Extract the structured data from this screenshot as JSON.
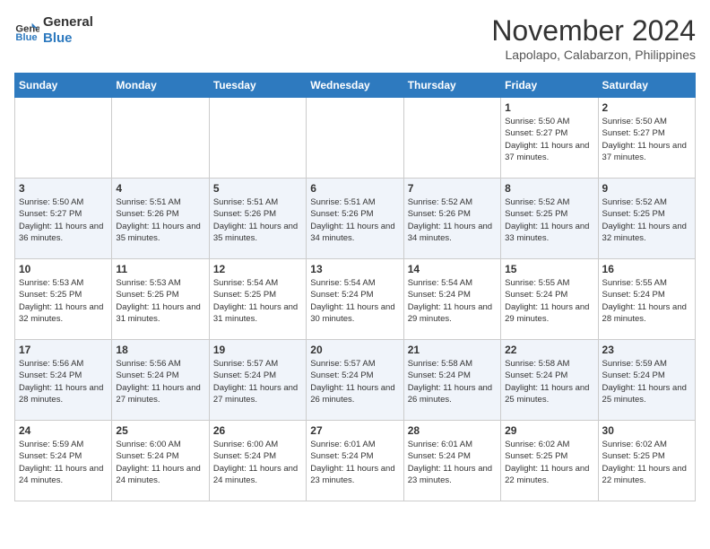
{
  "logo": {
    "line1": "General",
    "line2": "Blue"
  },
  "title": "November 2024",
  "location": "Lapolapo, Calabarzon, Philippines",
  "weekdays": [
    "Sunday",
    "Monday",
    "Tuesday",
    "Wednesday",
    "Thursday",
    "Friday",
    "Saturday"
  ],
  "weeks": [
    [
      {
        "day": "",
        "sunrise": "",
        "sunset": "",
        "daylight": ""
      },
      {
        "day": "",
        "sunrise": "",
        "sunset": "",
        "daylight": ""
      },
      {
        "day": "",
        "sunrise": "",
        "sunset": "",
        "daylight": ""
      },
      {
        "day": "",
        "sunrise": "",
        "sunset": "",
        "daylight": ""
      },
      {
        "day": "",
        "sunrise": "",
        "sunset": "",
        "daylight": ""
      },
      {
        "day": "1",
        "sunrise": "Sunrise: 5:50 AM",
        "sunset": "Sunset: 5:27 PM",
        "daylight": "Daylight: 11 hours and 37 minutes."
      },
      {
        "day": "2",
        "sunrise": "Sunrise: 5:50 AM",
        "sunset": "Sunset: 5:27 PM",
        "daylight": "Daylight: 11 hours and 37 minutes."
      }
    ],
    [
      {
        "day": "3",
        "sunrise": "Sunrise: 5:50 AM",
        "sunset": "Sunset: 5:27 PM",
        "daylight": "Daylight: 11 hours and 36 minutes."
      },
      {
        "day": "4",
        "sunrise": "Sunrise: 5:51 AM",
        "sunset": "Sunset: 5:26 PM",
        "daylight": "Daylight: 11 hours and 35 minutes."
      },
      {
        "day": "5",
        "sunrise": "Sunrise: 5:51 AM",
        "sunset": "Sunset: 5:26 PM",
        "daylight": "Daylight: 11 hours and 35 minutes."
      },
      {
        "day": "6",
        "sunrise": "Sunrise: 5:51 AM",
        "sunset": "Sunset: 5:26 PM",
        "daylight": "Daylight: 11 hours and 34 minutes."
      },
      {
        "day": "7",
        "sunrise": "Sunrise: 5:52 AM",
        "sunset": "Sunset: 5:26 PM",
        "daylight": "Daylight: 11 hours and 34 minutes."
      },
      {
        "day": "8",
        "sunrise": "Sunrise: 5:52 AM",
        "sunset": "Sunset: 5:25 PM",
        "daylight": "Daylight: 11 hours and 33 minutes."
      },
      {
        "day": "9",
        "sunrise": "Sunrise: 5:52 AM",
        "sunset": "Sunset: 5:25 PM",
        "daylight": "Daylight: 11 hours and 32 minutes."
      }
    ],
    [
      {
        "day": "10",
        "sunrise": "Sunrise: 5:53 AM",
        "sunset": "Sunset: 5:25 PM",
        "daylight": "Daylight: 11 hours and 32 minutes."
      },
      {
        "day": "11",
        "sunrise": "Sunrise: 5:53 AM",
        "sunset": "Sunset: 5:25 PM",
        "daylight": "Daylight: 11 hours and 31 minutes."
      },
      {
        "day": "12",
        "sunrise": "Sunrise: 5:54 AM",
        "sunset": "Sunset: 5:25 PM",
        "daylight": "Daylight: 11 hours and 31 minutes."
      },
      {
        "day": "13",
        "sunrise": "Sunrise: 5:54 AM",
        "sunset": "Sunset: 5:24 PM",
        "daylight": "Daylight: 11 hours and 30 minutes."
      },
      {
        "day": "14",
        "sunrise": "Sunrise: 5:54 AM",
        "sunset": "Sunset: 5:24 PM",
        "daylight": "Daylight: 11 hours and 29 minutes."
      },
      {
        "day": "15",
        "sunrise": "Sunrise: 5:55 AM",
        "sunset": "Sunset: 5:24 PM",
        "daylight": "Daylight: 11 hours and 29 minutes."
      },
      {
        "day": "16",
        "sunrise": "Sunrise: 5:55 AM",
        "sunset": "Sunset: 5:24 PM",
        "daylight": "Daylight: 11 hours and 28 minutes."
      }
    ],
    [
      {
        "day": "17",
        "sunrise": "Sunrise: 5:56 AM",
        "sunset": "Sunset: 5:24 PM",
        "daylight": "Daylight: 11 hours and 28 minutes."
      },
      {
        "day": "18",
        "sunrise": "Sunrise: 5:56 AM",
        "sunset": "Sunset: 5:24 PM",
        "daylight": "Daylight: 11 hours and 27 minutes."
      },
      {
        "day": "19",
        "sunrise": "Sunrise: 5:57 AM",
        "sunset": "Sunset: 5:24 PM",
        "daylight": "Daylight: 11 hours and 27 minutes."
      },
      {
        "day": "20",
        "sunrise": "Sunrise: 5:57 AM",
        "sunset": "Sunset: 5:24 PM",
        "daylight": "Daylight: 11 hours and 26 minutes."
      },
      {
        "day": "21",
        "sunrise": "Sunrise: 5:58 AM",
        "sunset": "Sunset: 5:24 PM",
        "daylight": "Daylight: 11 hours and 26 minutes."
      },
      {
        "day": "22",
        "sunrise": "Sunrise: 5:58 AM",
        "sunset": "Sunset: 5:24 PM",
        "daylight": "Daylight: 11 hours and 25 minutes."
      },
      {
        "day": "23",
        "sunrise": "Sunrise: 5:59 AM",
        "sunset": "Sunset: 5:24 PM",
        "daylight": "Daylight: 11 hours and 25 minutes."
      }
    ],
    [
      {
        "day": "24",
        "sunrise": "Sunrise: 5:59 AM",
        "sunset": "Sunset: 5:24 PM",
        "daylight": "Daylight: 11 hours and 24 minutes."
      },
      {
        "day": "25",
        "sunrise": "Sunrise: 6:00 AM",
        "sunset": "Sunset: 5:24 PM",
        "daylight": "Daylight: 11 hours and 24 minutes."
      },
      {
        "day": "26",
        "sunrise": "Sunrise: 6:00 AM",
        "sunset": "Sunset: 5:24 PM",
        "daylight": "Daylight: 11 hours and 24 minutes."
      },
      {
        "day": "27",
        "sunrise": "Sunrise: 6:01 AM",
        "sunset": "Sunset: 5:24 PM",
        "daylight": "Daylight: 11 hours and 23 minutes."
      },
      {
        "day": "28",
        "sunrise": "Sunrise: 6:01 AM",
        "sunset": "Sunset: 5:24 PM",
        "daylight": "Daylight: 11 hours and 23 minutes."
      },
      {
        "day": "29",
        "sunrise": "Sunrise: 6:02 AM",
        "sunset": "Sunset: 5:25 PM",
        "daylight": "Daylight: 11 hours and 22 minutes."
      },
      {
        "day": "30",
        "sunrise": "Sunrise: 6:02 AM",
        "sunset": "Sunset: 5:25 PM",
        "daylight": "Daylight: 11 hours and 22 minutes."
      }
    ]
  ]
}
